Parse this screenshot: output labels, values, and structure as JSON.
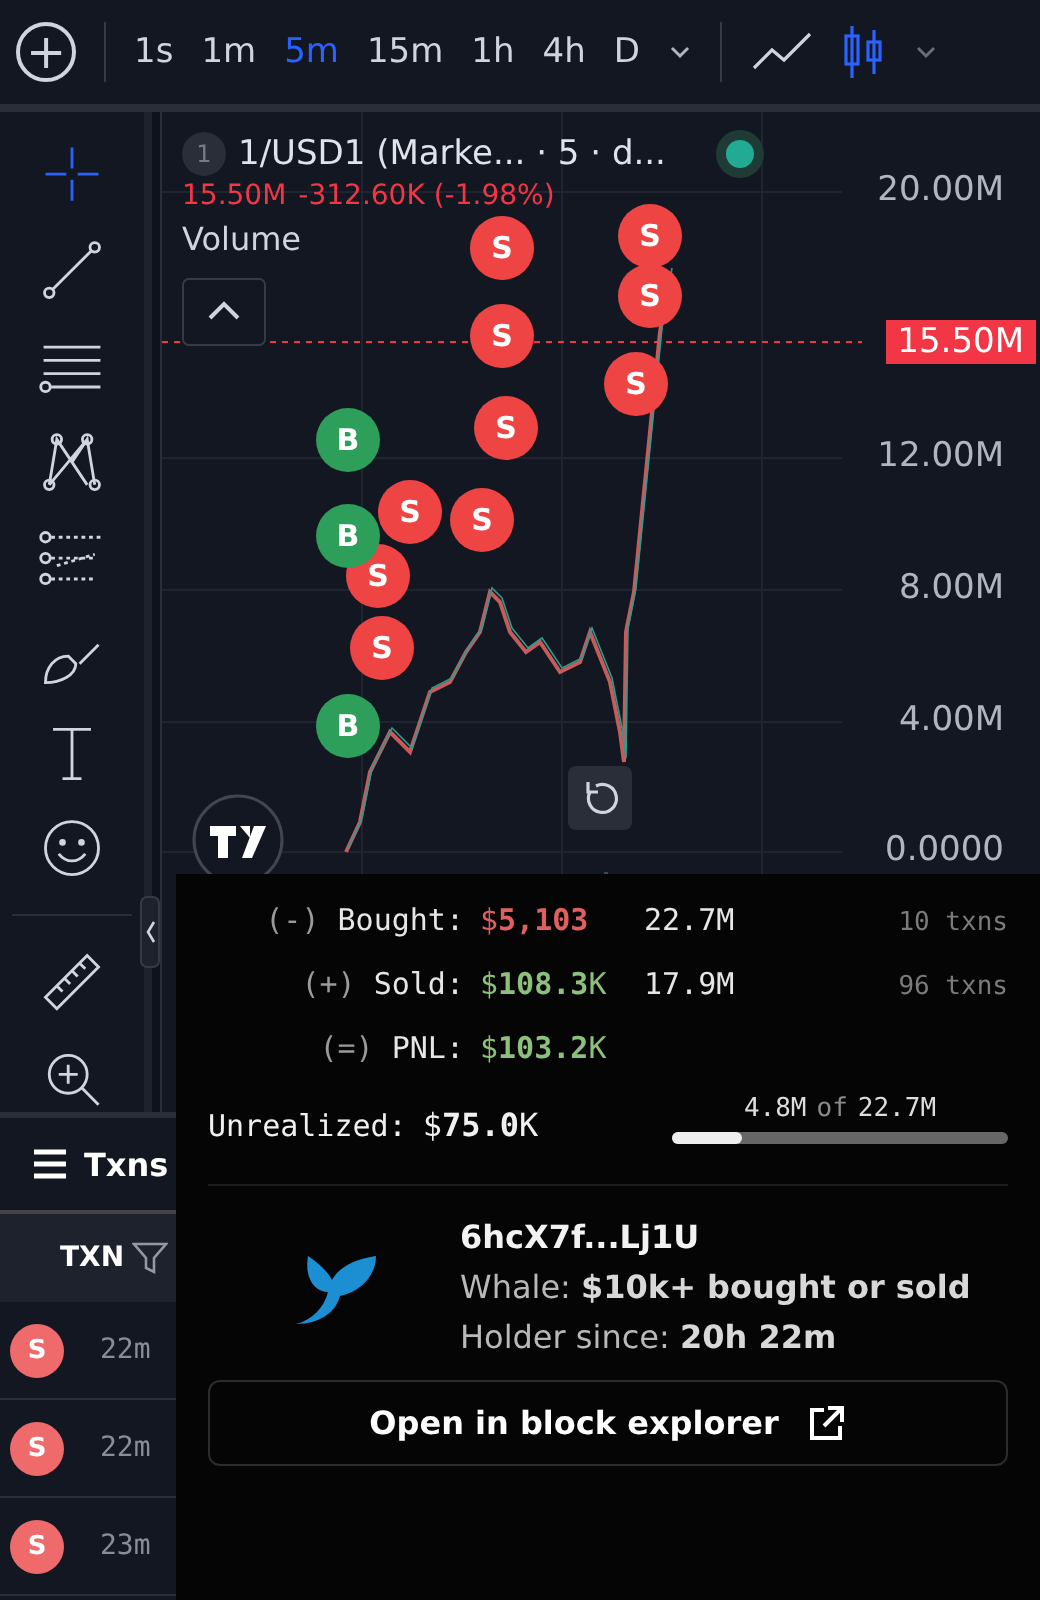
{
  "toolbar": {
    "add_label": "+",
    "intervals": [
      {
        "label": "1s",
        "selected": false
      },
      {
        "label": "1m",
        "selected": false
      },
      {
        "label": "5m",
        "selected": true
      },
      {
        "label": "15m",
        "selected": false
      },
      {
        "label": "1h",
        "selected": false
      },
      {
        "label": "4h",
        "selected": false
      },
      {
        "label": "D",
        "selected": false
      }
    ],
    "chart_types": [
      {
        "kind": "line",
        "selected": false
      },
      {
        "kind": "candles",
        "selected": true
      }
    ]
  },
  "tools": [
    {
      "kind": "crosshair",
      "selected": true
    },
    {
      "kind": "trendline",
      "selected": false
    },
    {
      "kind": "hlines",
      "selected": false
    },
    {
      "kind": "pattern",
      "selected": false
    },
    {
      "kind": "fib",
      "selected": false
    },
    {
      "kind": "brush",
      "selected": false
    },
    {
      "kind": "text",
      "selected": false
    },
    {
      "kind": "emoji",
      "selected": false
    },
    {
      "kind": "ruler",
      "selected": false
    },
    {
      "kind": "zoom",
      "selected": false
    }
  ],
  "chart": {
    "pane_number": "1",
    "symbol": "1/USD1 (Marke... · 5 · d...",
    "last": "15.50M",
    "change": "-312.60K (-1.98%)",
    "indicator": "Volume",
    "price_tag": "15.50M",
    "axis_labels": [
      "20.00M",
      "12.00M",
      "8.00M",
      "4.00M",
      "0.0000"
    ],
    "markers": [
      {
        "kind": "sell",
        "label": "S"
      },
      {
        "kind": "sell",
        "label": "S"
      },
      {
        "kind": "sell",
        "label": "S"
      },
      {
        "kind": "sell",
        "label": "S"
      },
      {
        "kind": "sell",
        "label": "S"
      },
      {
        "kind": "sell",
        "label": "S"
      },
      {
        "kind": "sell",
        "label": "S"
      },
      {
        "kind": "sell",
        "label": "S"
      },
      {
        "kind": "sell",
        "label": "S"
      },
      {
        "kind": "sell",
        "label": "S"
      },
      {
        "kind": "buy",
        "label": "B"
      },
      {
        "kind": "buy",
        "label": "B"
      },
      {
        "kind": "buy",
        "label": "B"
      }
    ]
  },
  "txns": {
    "title": "Txns",
    "column": "TXN",
    "rows": [
      {
        "side": "S",
        "age": "22m"
      },
      {
        "side": "S",
        "age": "22m"
      },
      {
        "side": "S",
        "age": "23m"
      }
    ]
  },
  "popup": {
    "stats": [
      {
        "sign": "(-)",
        "label": "Bought:",
        "value": "$**5,103**",
        "kind": "loss",
        "amount": "22.7M",
        "txns": "10 txns"
      },
      {
        "sign": "(+)",
        "label": "Sold:",
        "value": "$**108.3**K",
        "kind": "gain",
        "amount": "17.9M",
        "txns": "96 txns"
      },
      {
        "sign": "(=)",
        "label": "PNL:",
        "value": "$**103.2**K",
        "kind": "gain"
      }
    ],
    "unrealized": {
      "label": "Unrealized:",
      "value": "$**75.0**K",
      "held": "4.8M",
      "of": "of",
      "total": "22.7M",
      "level": 0.21
    },
    "wallet": {
      "address": "6hcX7f...Lj1U",
      "tag": "Whale: **$10k+ bought or sold**",
      "since": "Holder since: **20h 22m**"
    },
    "button": "Open in block explorer"
  }
}
